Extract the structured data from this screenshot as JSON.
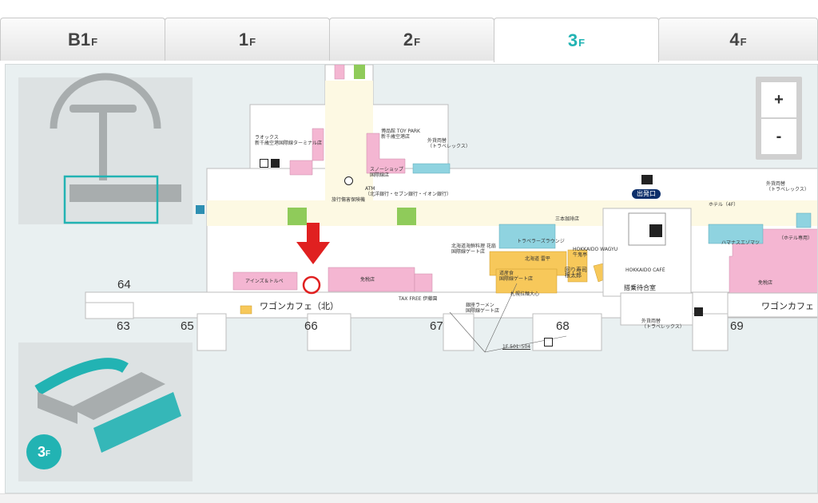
{
  "tabs": [
    {
      "main": "B1",
      "suffix": "F"
    },
    {
      "main": "1",
      "suffix": "F"
    },
    {
      "main": "2",
      "suffix": "F"
    },
    {
      "main": "3",
      "suffix": "F"
    },
    {
      "main": "4",
      "suffix": "F"
    }
  ],
  "active_tab": "3F",
  "zoom": {
    "in_label": "+",
    "out_label": "-"
  },
  "floor_badge": {
    "main": "3",
    "suffix": "F"
  },
  "gates": [
    "63",
    "64",
    "65",
    "66",
    "67",
    "68",
    "69"
  ],
  "labels": {
    "wagon_north": "ワゴンカフェ（北）",
    "wagon_south": "ワゴンカフェ（南",
    "departure": "出発口",
    "waiting_room": "搭乗待合室",
    "shop_rafox": "ラオックス\n新千歳空港国際線ターミナル店",
    "shop_toypark": "博品館 TOY PARK\n新千歳空港店",
    "exchange_travelex": "外貨両替\n（トラベレックス）",
    "snow_shop": "スノーショップ\n国際線店",
    "atm": "ATM\n（北洋銀行・セブン銀行・イオン銀行）",
    "travel_insurance": "旅行傷害保険機",
    "sanmaru": "三本珈琲店",
    "shinsen": "北海道海鮮料理 花扇\n国際線ゲート店",
    "kitakaido": "北海道 雷平",
    "hokkaido_wagyu": "HOKKAIDO WAGYU\n牛鬼亭",
    "travelers_lounge": "トラベラーズラウンジ",
    "hokkaido_cafe": "HOKKAIDO CAFÉ",
    "ains": "アインズ＆トルペ",
    "duty_free": "免税店",
    "tax_free": "TAX FREE 伊藤園",
    "ramen": "札幌拉麺大心",
    "sushi": "回り寿司\n根太郎",
    "sauna": "銀座ラーメン\n国際線ゲート店",
    "kagome": "道産食\n国際線ゲート店",
    "hotel": "ホテル（4F）",
    "hotel_rec": "（ホテル専用）",
    "exchange_travelex_east": "外貨両替\n（トラベレックス）",
    "exchange_travelex_south": "外貨両替\n（トラベレックス）",
    "hamanasu": "ハマナス",
    "ezomatsu": "エゾマツ",
    "free_shop": "免税店",
    "first_floor": "1F 501–504"
  },
  "colors": {
    "accent": "#22b3b3",
    "shop": "#f4b6d2",
    "food": "#f7c85a",
    "lounge": "#8fd3e0",
    "corridor": "#fdf9e3",
    "wall": "#ffffff",
    "marker": "#e02020"
  },
  "icons": [
    "restroom-icon",
    "elevator-icon",
    "info-icon",
    "escalator-icon",
    "departure-plane-icon",
    "locker-icon",
    "arrow-down-marker-icon"
  ]
}
